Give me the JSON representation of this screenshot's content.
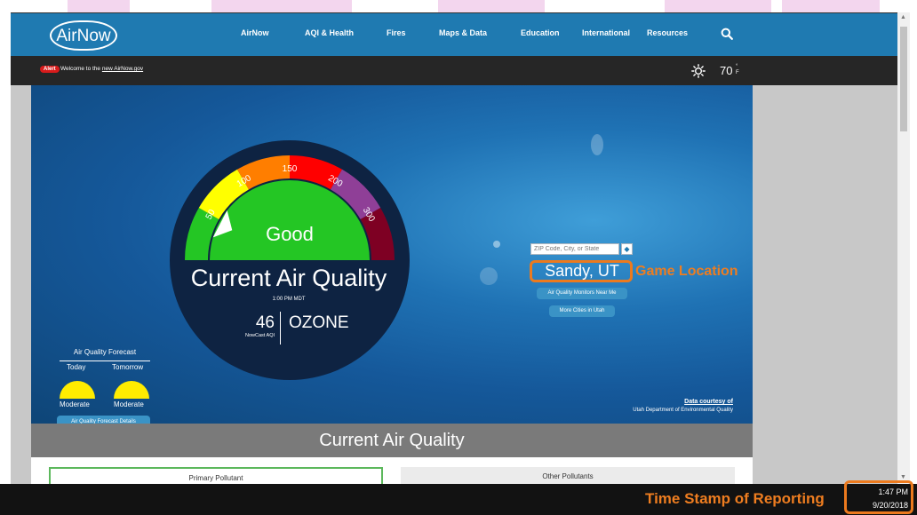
{
  "navbar": {
    "logo": "AirNow",
    "items": [
      {
        "label": "AirNow"
      },
      {
        "label": "AQI & Health"
      },
      {
        "label": "Fires"
      },
      {
        "label": "Maps & Data"
      },
      {
        "label": "Education"
      },
      {
        "label": "International"
      },
      {
        "label": "Resources"
      }
    ],
    "search_icon": "search-icon"
  },
  "alert": {
    "badge": "Alert",
    "text": "Welcome to the",
    "link": "new AirNow.gov"
  },
  "weather": {
    "icon": "sun-icon",
    "temp": "70",
    "unit_top": "°",
    "unit_bottom": "F"
  },
  "gauge": {
    "level": "Good",
    "ticks": [
      "50",
      "100",
      "150",
      "200",
      "300"
    ],
    "title": "Current Air Quality",
    "time": "1:00 PM MDT",
    "aqi_value": "46",
    "aqi_label": "NowCast AQI",
    "pollutant": "OZONE",
    "value_fraction": 0.153,
    "colors": {
      "good": "#24c624",
      "moderate": "#ffff00",
      "usg": "#ff7e00",
      "unhealthy": "#ff0000",
      "very_unhealthy": "#8f3f97",
      "hazardous": "#7e0023"
    }
  },
  "forecast": {
    "title": "Air Quality Forecast",
    "today_label": "Today",
    "tomorrow_label": "Tomorrow",
    "today_level": "Moderate",
    "tomorrow_level": "Moderate",
    "details_button": "Air Quality Forecast Details"
  },
  "location": {
    "placeholder": "ZIP Code, City, or State",
    "city": "Sandy, UT",
    "monitors_button": "Air Quality Monitors Near Me",
    "more_cities_button": "More Cities in Utah"
  },
  "annotations": {
    "game_location": "Game Location",
    "time_stamp": "Time Stamp of Reporting",
    "accent_color": "#ee7d20"
  },
  "credit": {
    "link": "Data courtesy of",
    "source": "Utah Department of Environmental Quality"
  },
  "section": {
    "title": "Current Air Quality",
    "primary_tab": "Primary Pollutant",
    "other_tab": "Other Pollutants"
  },
  "taskbar": {
    "time": "1:47 PM",
    "date": "9/20/2018"
  }
}
